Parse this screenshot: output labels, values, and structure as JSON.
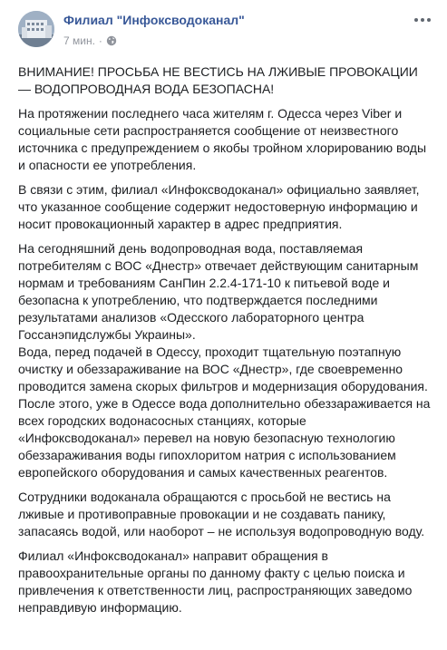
{
  "post": {
    "author": "Филиал \"Инфоксводоканал\"",
    "time": "7 мин.",
    "separator": "·",
    "privacy_icon": "globe-icon",
    "more_icon": "more-options-icon",
    "paragraphs": [
      "ВНИМАНИЕ! ПРОСЬБА НЕ ВЕСТИСЬ НА ЛЖИВЫЕ ПРОВОКАЦИИ — ВОДОПРОВОДНАЯ ВОДА БЕЗОПАСНА!",
      "На протяжении последнего часа жителям г. Одесса через Viber и социальные сети распространяется сообщение от неизвестного источника с предупреждением о якобы тройном хлорированию воды и опасности ее употребления.",
      "В связи с этим, филиал «Инфоксводоканал» официально заявляет, что указанное сообщение содержит недостоверную информацию и носит провокационный характер в адрес предприятия.",
      "На сегодняшний день водопроводная вода, поставляемая потребителям с ВОС «Днестр» отвечает действующим санитарным нормам и требованиям СанПин 2.2.4-171-10 к питьевой воде и безопасна к употреблению, что подтверждается последними результатами анализов «Одесского лабораторного центра Госсанэпидслужбы Украины».",
      "Вода, перед подачей в Одессу, проходит тщательную поэтапную очистку и обеззараживание на ВОС «Днестр», где своевременно проводится замена скорых фильтров и модернизация оборудования. После этого, уже в Одессе вода дополнительно обеззараживается на всех городских водонасосных станциях, которые «Инфоксводоканал» перевел на новую безопасную технологию обеззараживания воды гипохлоритом натрия с использованием европейского оборудования и самых качественных реагентов.",
      "Сотрудники водоканала обращаются с просьбой не вестись на лживые и противоправные провокации и не создавать панику, запасаясь водой, или наоборот – не используя водопроводную воду.",
      "Филиал «Инфоксводоканал» направит обращения в правоохранительные органы по данному факту с целью поиска и привлечения к ответственности лиц, распространяющих заведомо неправдивую информацию."
    ]
  },
  "colors": {
    "author": "#385898",
    "meta": "#90949c",
    "text": "#1c1e21"
  }
}
